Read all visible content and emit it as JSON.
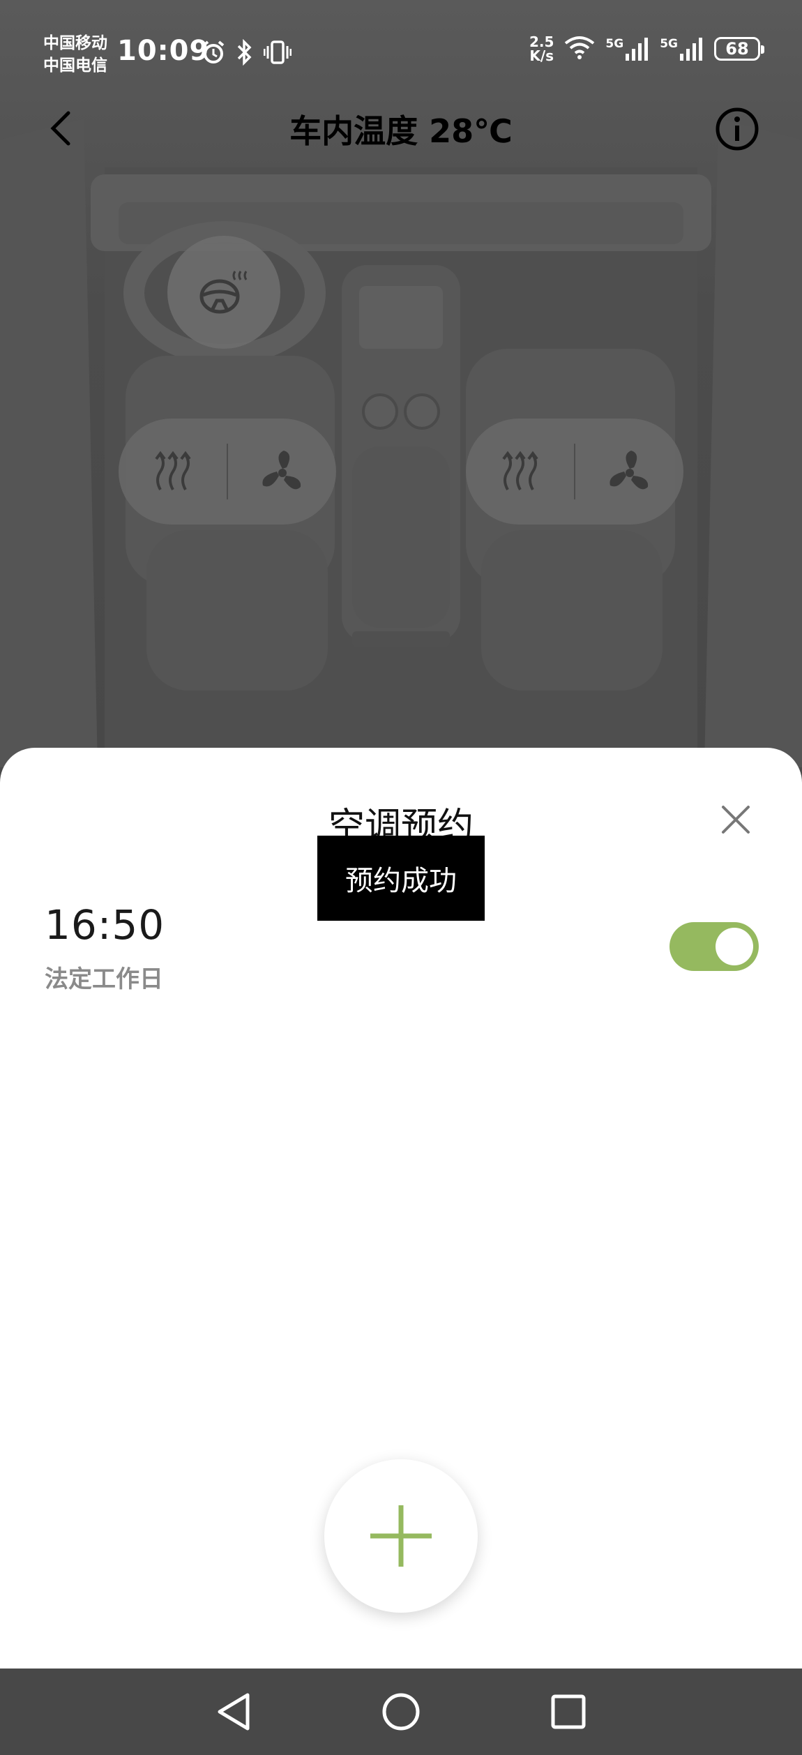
{
  "status_bar": {
    "carrier_1": "中国移动",
    "carrier_2": "中国电信",
    "time": "10:09",
    "net_speed_value": "2.5",
    "net_speed_unit": "K/s",
    "network_1": "5G",
    "network_2": "5G",
    "battery": "68",
    "icons": [
      "alarm-icon",
      "bluetooth-icon",
      "vibrate-icon",
      "wifi-icon",
      "signal-icon",
      "battery-icon"
    ]
  },
  "header": {
    "title": "车内温度 28℃",
    "back_icon": "chevron-left-icon",
    "info_icon": "info-icon"
  },
  "car_controls": {
    "steering_wheel_icon": "steering-wheel-heat-icon",
    "seat_heat_icon": "seat-heat-icon",
    "seat_vent_icon": "fan-icon"
  },
  "sheet": {
    "title": "空调预约",
    "close_icon": "close-icon",
    "schedules": [
      {
        "time": "16:50",
        "repeat": "法定工作日",
        "enabled": true
      }
    ],
    "add_icon": "plus-icon"
  },
  "toast": {
    "message": "预约成功"
  },
  "colors": {
    "accent_green": "#95b95f",
    "overlay": "#4a4a4a",
    "toast_bg": "#000000"
  },
  "nav_bar": {
    "icons": [
      "back-triangle-icon",
      "home-circle-icon",
      "recents-square-icon"
    ]
  }
}
